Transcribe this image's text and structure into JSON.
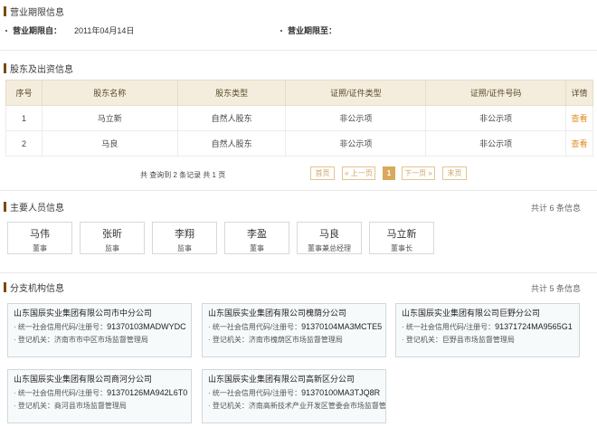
{
  "business_term": {
    "title": "营业期限信息",
    "from_label": "营业期限自：",
    "from_value": "2011年04月14日",
    "to_label": "营业期限至：",
    "to_value": ""
  },
  "shareholders": {
    "title": "股东及出资信息",
    "columns": [
      "序号",
      "股东名称",
      "股东类型",
      "证照/证件类型",
      "证照/证件号码",
      "详情"
    ],
    "rows": [
      [
        "1",
        "马立新",
        "自然人股东",
        "非公示项",
        "非公示项",
        "查看"
      ],
      [
        "2",
        "马良",
        "自然人股东",
        "非公示项",
        "非公示项",
        "查看"
      ]
    ],
    "pager": {
      "info": "共 查询到 2 条记录 共 1 页",
      "first": "首页",
      "prev": "« 上一页",
      "current": "1",
      "next": "下一页 »",
      "last": "末页"
    }
  },
  "personnel": {
    "title": "主要人员信息",
    "count": "共计 6 条信息",
    "people": [
      {
        "name": "马伟",
        "role": "董事"
      },
      {
        "name": "张昕",
        "role": "监事"
      },
      {
        "name": "李翔",
        "role": "监事"
      },
      {
        "name": "李盈",
        "role": "董事"
      },
      {
        "name": "马良",
        "role": "董事兼总经理"
      },
      {
        "name": "马立新",
        "role": "董事长"
      }
    ]
  },
  "branches": {
    "title": "分支机构信息",
    "count": "共计 5 条信息",
    "code_label": "统一社会信用代码/注册号：",
    "auth_label": "登记机关：",
    "items": [
      {
        "name": "山东国辰实业集团有限公司市中分公司",
        "code": "91370103MADWYDC",
        "auth": "济南市市中区市场监督管理局"
      },
      {
        "name": "山东国辰实业集团有限公司槐荫分公司",
        "code": "91370104MA3MCTE5",
        "auth": "济南市槐荫区市场监督管理局"
      },
      {
        "name": "山东国辰实业集团有限公司巨野分公司",
        "code": "91371724MA9565G1",
        "auth": "巨野县市场监督管理局"
      },
      {
        "name": "山东国辰实业集团有限公司商河分公司",
        "code": "91370126MA942L6T0",
        "auth": "商河县市场监督管理局"
      },
      {
        "name": "山东国辰实业集团有限公司高新区分公司",
        "code": "91370100MA3TJQ8R",
        "auth": "济南高新技术产业开发区管委会市场监督管理局"
      }
    ]
  }
}
